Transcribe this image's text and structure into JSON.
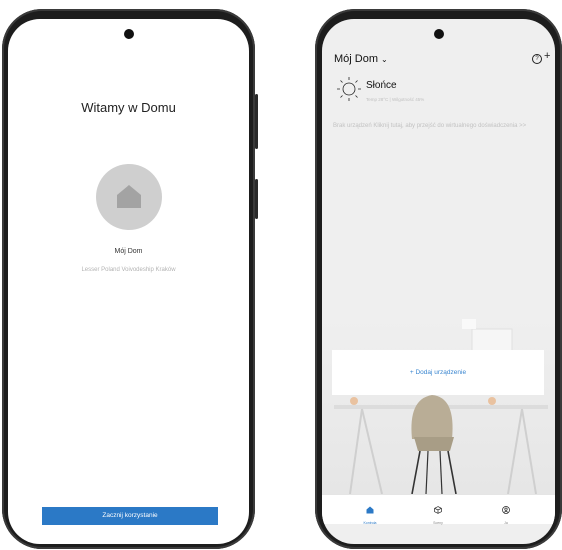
{
  "welcome": {
    "title": "Witamy w Domu",
    "home_name": "Mój Dom",
    "location": "Lesser Poland Voivodeship Kraków",
    "start_button": "Zacznij korzystanie"
  },
  "home": {
    "header": {
      "home_name": "Mój Dom",
      "chevron": "⌄",
      "help": "?",
      "add": "+"
    },
    "weather": {
      "title": "Słońce",
      "details": "Temp 28°C | Wilgotność 45%"
    },
    "empty_message": "Brak urządzeń Kliknij tutaj, aby przejść do wirtualnego doświadczenia >>",
    "add_device_button": "+ Dodaj urządzenie",
    "nav": [
      {
        "label": "Kontrola",
        "icon": "home-icon"
      },
      {
        "label": "Sceny",
        "icon": "cube-icon"
      },
      {
        "label": "Ja",
        "icon": "user-icon"
      }
    ]
  },
  "colors": {
    "accent": "#2b79c6",
    "link": "#3a86d0",
    "avatar": "#cfcfcf",
    "phone": "#1d1d1d"
  }
}
